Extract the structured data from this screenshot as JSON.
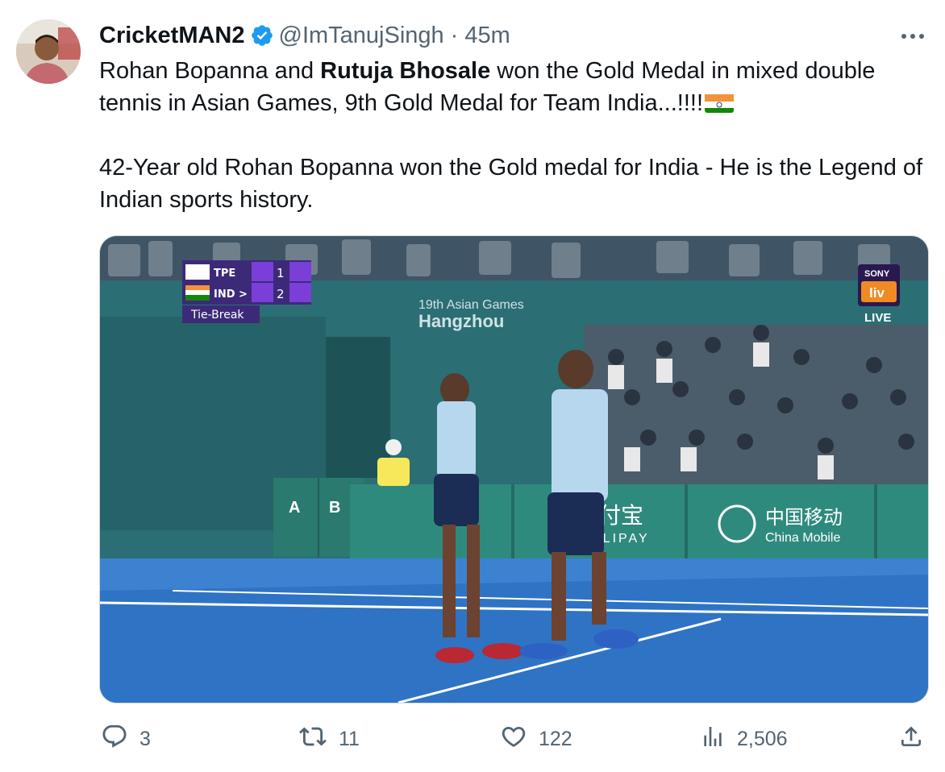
{
  "tweet": {
    "display_name": "CricketMAN2",
    "verified_icon": "verified-badge-icon",
    "handle": "@ImTanujSingh",
    "separator": "·",
    "time": "45m",
    "more_icon": "more-horizontal-icon",
    "text": {
      "line1_part1": "Rohan Bopanna and ",
      "line1_bold": "Rutuja Bhosale",
      "line1_part2": " won the Gold Medal in mixed double tennis in Asian Games, 9th Gold Medal for Team India...!!!!",
      "flag_icon": "india-flag-emoji",
      "paragraph2": "42-Year old Rohan Bopanna won the Gold medal for India - He is the Legend of Indian sports history."
    }
  },
  "media": {
    "scoreboard": {
      "team1": "TPE",
      "team1_score": "1",
      "team2": "IND >",
      "team2_score": "2",
      "label": "Tie-Break"
    },
    "venue_line1": "19th Asian Games",
    "venue_line2": "Hangzhou",
    "broadcaster": "SONY",
    "broadcaster_sub": "liv",
    "live_label": "LIVE",
    "court_signs": [
      "A",
      "B"
    ],
    "sponsor1": "支付宝",
    "sponsor1_sub": "ALIPAY",
    "sponsor2": "中国移动",
    "sponsor2_sub": "China Mobile"
  },
  "actions": {
    "reply_count": "3",
    "retweet_count": "11",
    "like_count": "122",
    "views_count": "2,506"
  },
  "colors": {
    "accent": "#1d9bf0",
    "muted": "#536471",
    "court_blue": "#2f73c4",
    "wall_teal": "#2b6e74"
  }
}
